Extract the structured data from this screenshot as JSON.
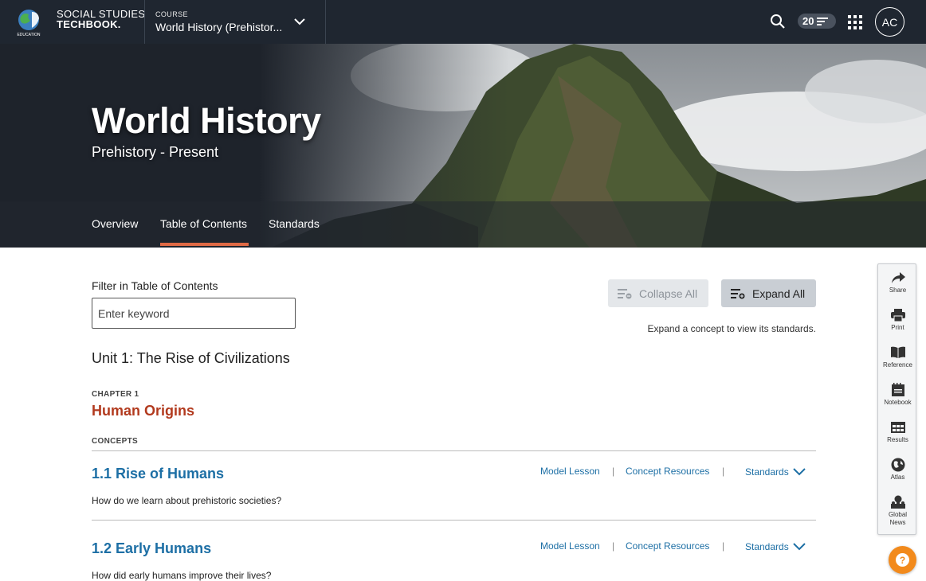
{
  "brand": {
    "line1": "SOCIAL STUDIES",
    "line2": "TECHBOOK.",
    "logo_sub": "EDUCATION"
  },
  "course": {
    "label": "COURSE",
    "name": "World History (Prehistor..."
  },
  "header": {
    "notification_count": "20",
    "avatar_initials": "AC"
  },
  "hero": {
    "title": "World History",
    "subtitle": "Prehistory - Present"
  },
  "tabs": [
    {
      "label": "Overview",
      "active": false
    },
    {
      "label": "Table of Contents",
      "active": true
    },
    {
      "label": "Standards",
      "active": false
    }
  ],
  "filter": {
    "label": "Filter in Table of Contents",
    "placeholder": "Enter keyword",
    "value": ""
  },
  "buttons": {
    "collapse_all": "Collapse All",
    "expand_all": "Expand All"
  },
  "hint": "Expand a concept to view its standards.",
  "unit": {
    "title": "Unit 1: The Rise of Civilizations"
  },
  "chapter": {
    "label": "CHAPTER 1",
    "title": "Human Origins"
  },
  "concepts_label": "CONCEPTS",
  "concepts": [
    {
      "title": "1.1 Rise of Humans",
      "question": "How do we learn about prehistoric societies?",
      "model_lesson": "Model Lesson",
      "resources": "Concept Resources",
      "standards": "Standards"
    },
    {
      "title": "1.2 Early Humans",
      "question": "How did early humans improve their lives?",
      "model_lesson": "Model Lesson",
      "resources": "Concept Resources",
      "standards": "Standards"
    }
  ],
  "sidebar": [
    {
      "label": "Share",
      "icon": "share-icon"
    },
    {
      "label": "Print",
      "icon": "print-icon"
    },
    {
      "label": "Reference",
      "icon": "book-icon"
    },
    {
      "label": "Notebook",
      "icon": "notebook-icon"
    },
    {
      "label": "Results",
      "icon": "results-icon"
    },
    {
      "label": "Atlas",
      "icon": "globe-icon"
    },
    {
      "label": "Global",
      "label2": "News",
      "icon": "global-news-icon"
    }
  ],
  "colors": {
    "topbar": "#1f2630",
    "accent": "#e06a45",
    "chapter": "#b23a1e",
    "link": "#1d6fa5",
    "help": "#f28a1c"
  }
}
